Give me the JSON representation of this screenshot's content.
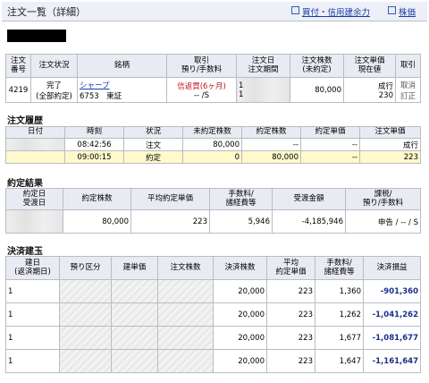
{
  "header": {
    "title": "注文一覧（詳細）",
    "link_power": "買付・信用建余力",
    "link_stock": "株価"
  },
  "orders_table": {
    "headers": [
      [
        "注文",
        "番号"
      ],
      [
        "注文状況",
        ""
      ],
      [
        "銘柄",
        ""
      ],
      [
        "取引",
        "預り/手数料"
      ],
      [
        "注文日",
        "注文期間"
      ],
      [
        "注文株数",
        "(未約定)"
      ],
      [
        "注文単価",
        "現在値"
      ],
      [
        "取引",
        ""
      ]
    ],
    "row": {
      "number": "4219",
      "status1": "完了",
      "status2": "(全部約定)",
      "name": "シャープ",
      "code_market": "6753　東証",
      "trade_type": "信返買(6ヶ月)",
      "deposit_fee": "-- /S",
      "date1": "1",
      "date2": "1",
      "shares": "80,000",
      "price_type": "成行",
      "current": "230",
      "action1": "取消",
      "action2": "訂正"
    }
  },
  "history": {
    "section_title": "注文履歴",
    "headers": [
      "日付",
      "時刻",
      "状況",
      "未約定株数",
      "約定株数",
      "約定単価",
      "注文単価"
    ],
    "rows": [
      {
        "time": "08:42:56",
        "status": "注文",
        "unfilled": "80,000",
        "filled": "--",
        "fill_price": "--",
        "order_price": "成行"
      },
      {
        "time": "09:00:15",
        "status": "約定",
        "unfilled": "0",
        "filled": "80,000",
        "fill_price": "--",
        "order_price": "223"
      }
    ]
  },
  "result": {
    "section_title": "約定結果",
    "headers": [
      [
        "約定日",
        "受渡日"
      ],
      [
        "約定株数",
        ""
      ],
      [
        "平均約定単価",
        ""
      ],
      [
        "手数料/",
        "諸経費等"
      ],
      [
        "受渡金額",
        ""
      ],
      [
        "課税/",
        "預り/手数料"
      ]
    ],
    "row": {
      "shares": "80,000",
      "avg_price": "223",
      "fee": "5,946",
      "amount": "-4,185,946",
      "tax": "申告 / -- / S"
    }
  },
  "settlement": {
    "section_title": "決済建玉",
    "headers": [
      [
        "建日",
        "(返済期日)"
      ],
      [
        "預り区分",
        ""
      ],
      [
        "建単価",
        ""
      ],
      [
        "注文株数",
        ""
      ],
      [
        "決済株数",
        ""
      ],
      [
        "平均",
        "約定単価"
      ],
      [
        "手数料/",
        "諸経費等"
      ],
      [
        "決済損益",
        ""
      ]
    ],
    "rows": [
      {
        "d": "1",
        "qty": "20,000",
        "avg": "223",
        "fee": "1,360",
        "pl": "-901,360"
      },
      {
        "d": "1",
        "qty": "20,000",
        "avg": "223",
        "fee": "1,262",
        "pl": "-1,041,262"
      },
      {
        "d": "1",
        "qty": "20,000",
        "avg": "223",
        "fee": "1,677",
        "pl": "-1,081,677"
      },
      {
        "d": "1",
        "qty": "20,000",
        "avg": "223",
        "fee": "1,647",
        "pl": "-1,161,647"
      }
    ]
  }
}
